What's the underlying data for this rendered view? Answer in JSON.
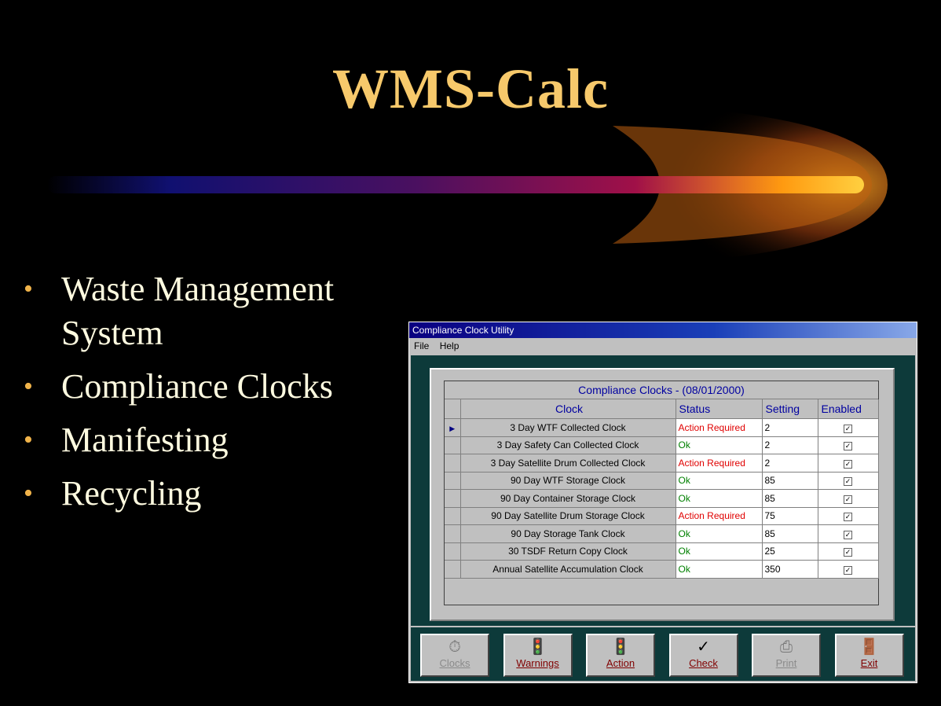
{
  "slide": {
    "title": "WMS-Calc",
    "bullets": [
      "Waste Management System",
      "Compliance Clocks",
      "Manifesting",
      "Recycling"
    ]
  },
  "window": {
    "title": "Compliance Clock Utility",
    "menu": [
      "File",
      "Help"
    ],
    "grid": {
      "caption": "Compliance Clocks - (08/01/2000)",
      "columns": [
        "Clock",
        "Status",
        "Setting",
        "Enabled"
      ],
      "rows": [
        {
          "clock": "3 Day WTF Collected Clock",
          "status": "Action Required",
          "setting": "2",
          "enabled": true
        },
        {
          "clock": "3 Day Safety Can Collected Clock",
          "status": "Ok",
          "setting": "2",
          "enabled": true
        },
        {
          "clock": "3 Day Satellite Drum Collected Clock",
          "status": "Action Required",
          "setting": "2",
          "enabled": true
        },
        {
          "clock": "90 Day WTF Storage Clock",
          "status": "Ok",
          "setting": "85",
          "enabled": true
        },
        {
          "clock": "90 Day Container Storage Clock",
          "status": "Ok",
          "setting": "85",
          "enabled": true
        },
        {
          "clock": "90 Day Satellite Drum Storage Clock",
          "status": "Action Required",
          "setting": "75",
          "enabled": true
        },
        {
          "clock": "90 Day Storage Tank Clock",
          "status": "Ok",
          "setting": "85",
          "enabled": true
        },
        {
          "clock": "30 TSDF Return Copy Clock",
          "status": "Ok",
          "setting": "25",
          "enabled": true
        },
        {
          "clock": "Annual Satellite Accumulation Clock",
          "status": "Ok",
          "setting": "350",
          "enabled": true
        }
      ]
    },
    "toolbar": [
      {
        "label": "Clocks",
        "icon": "stopwatch-icon",
        "glyph": "⏱",
        "enabled": false
      },
      {
        "label": "Warnings",
        "icon": "traffic-light-icon",
        "glyph": "🚦",
        "enabled": true
      },
      {
        "label": "Action",
        "icon": "traffic-light-icon",
        "glyph": "🚦",
        "enabled": true
      },
      {
        "label": "Check",
        "icon": "checkmark-icon",
        "glyph": "✓",
        "enabled": true
      },
      {
        "label": "Print",
        "icon": "printer-icon",
        "glyph": "⎙",
        "enabled": false
      },
      {
        "label": "Exit",
        "icon": "exit-door-icon",
        "glyph": "🚪",
        "enabled": true
      }
    ],
    "colors": {
      "titlebar": "#0a0080",
      "status_error": "#e00000",
      "status_ok": "#008000"
    }
  }
}
